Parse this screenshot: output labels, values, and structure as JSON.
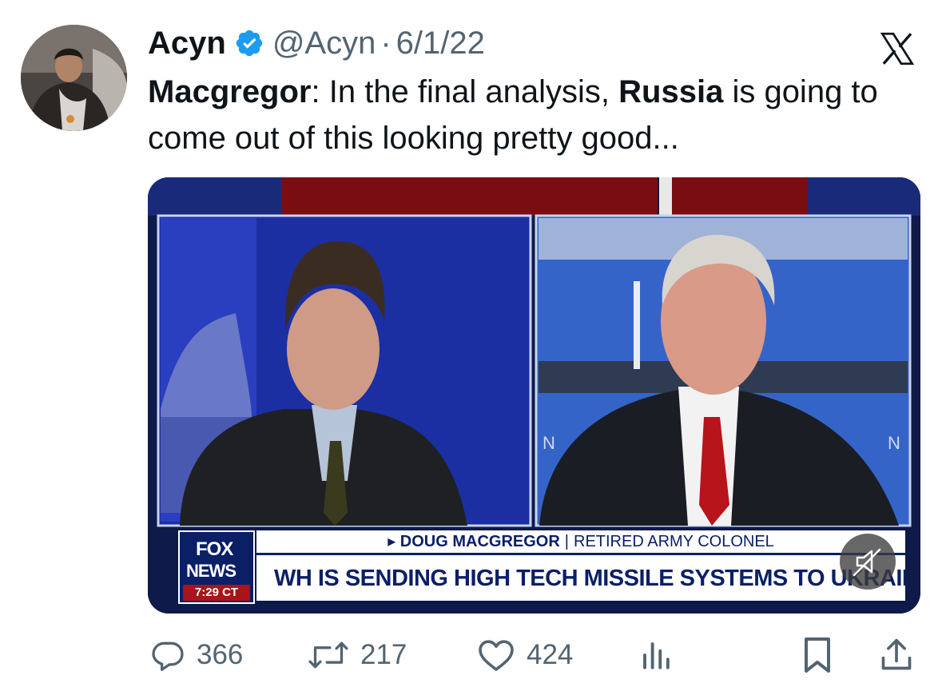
{
  "tweet": {
    "author": {
      "display_name": "Acyn",
      "handle": "@Acyn",
      "verified": true
    },
    "separator": "·",
    "date": "6/1/22",
    "text_parts": [
      {
        "text": "Macgregor",
        "bold": true
      },
      {
        "text": ": In the final analysis, ",
        "bold": false
      },
      {
        "text": "Russia",
        "bold": true
      },
      {
        "text": " is going to come out of this looking pretty good...",
        "bold": false
      }
    ]
  },
  "media": {
    "network_logo_top": "FOX",
    "network_logo_bottom": "NEWS",
    "time": "7:29 CT",
    "lower_third_name": "DOUG MACGREGOR",
    "lower_third_divider": "|",
    "lower_third_title": "RETIRED ARMY COLONEL",
    "headline": "WH IS SENDING HIGH TECH MISSILE SYSTEMS TO UKRAINE"
  },
  "actions": {
    "replies": "366",
    "reposts": "217",
    "likes": "424"
  },
  "icons": {
    "brand": "x-logo-icon",
    "verified": "verified-badge-icon",
    "reply": "reply-icon",
    "repost": "repost-icon",
    "like": "heart-icon",
    "views": "views-bar-chart-icon",
    "bookmark": "bookmark-icon",
    "share": "share-icon",
    "mute": "muted-speaker-icon"
  },
  "colors": {
    "text_primary": "#0f1419",
    "text_secondary": "#536471",
    "verified_blue": "#1d9bf0",
    "fox_navy": "#0a1f66",
    "fox_red": "#a8141a"
  }
}
